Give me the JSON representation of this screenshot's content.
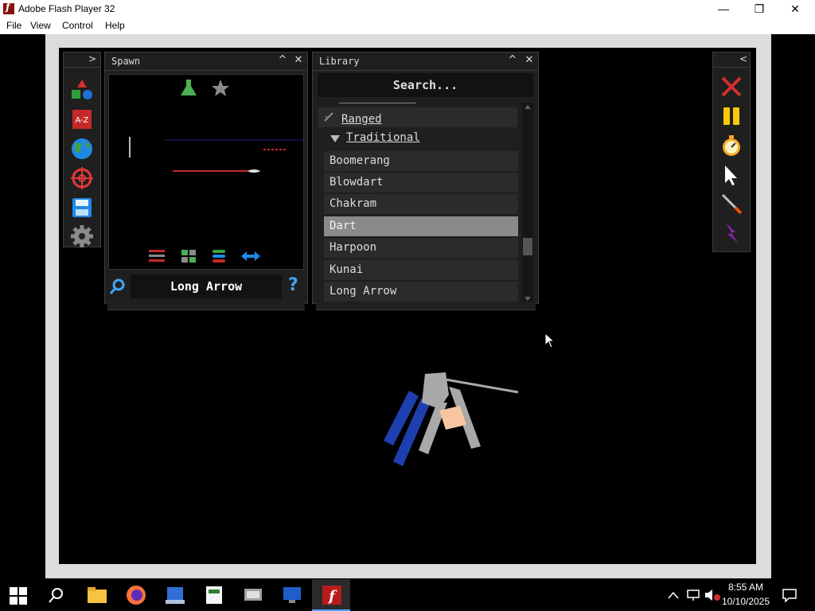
{
  "window": {
    "title": "Adobe Flash Player 32",
    "controls": {
      "minimize": "—",
      "maximize": "❐",
      "close": "✕"
    }
  },
  "menu": [
    "File",
    "View",
    "Control",
    "Help"
  ],
  "spawn_panel": {
    "title": "Spawn",
    "collapse_glyph": "^",
    "close_glyph": "✕",
    "selected_item": "Long Arrow",
    "help_glyph": "?"
  },
  "library_panel": {
    "title": "Library",
    "collapse_glyph": "^",
    "close_glyph": "✕",
    "search_placeholder": "Search...",
    "categories": [
      {
        "label": "Ranged",
        "expanded": false
      },
      {
        "label": "Traditional",
        "expanded": true
      }
    ],
    "items": [
      "Boomerang",
      "Blowdart",
      "Chakram",
      "Dart",
      "Harpoon",
      "Kunai",
      "Long Arrow"
    ],
    "selected": "Dart"
  },
  "left_toolbar": {
    "chevron": ">",
    "tools": [
      "shapes-icon",
      "a-z-icon",
      "globe-icon",
      "target-icon",
      "save-icon",
      "gear-icon"
    ]
  },
  "right_toolbar": {
    "chevron": "<",
    "tools": [
      "close-x-icon",
      "pause-icon",
      "stopwatch-icon",
      "cursor-icon",
      "sword-icon",
      "lightning-icon"
    ]
  },
  "taskbar": {
    "time": "8:55 AM",
    "date": "10/10/2025"
  },
  "colors": {
    "panel_bg": "#1f1f1f",
    "selected_row": "#8a8a8a",
    "flash_red": "#8a1010",
    "taskbar_accent": "#4fa3ff"
  }
}
